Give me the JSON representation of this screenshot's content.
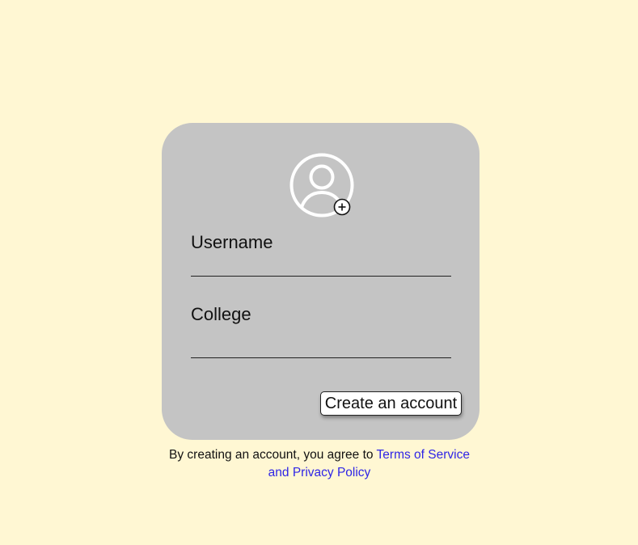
{
  "colors": {
    "background": "#fff7d3",
    "card": "#c4c4c4",
    "link": "#2f25e6",
    "avatar_stroke": "#ffffff"
  },
  "avatar": {
    "icon": "user-circle-icon",
    "badge_icon": "add-circle-icon"
  },
  "form": {
    "username_label": "Username",
    "username_value": "",
    "college_label": "College",
    "college_value": "",
    "submit_label": "Create an account"
  },
  "terms": {
    "prefix": "By creating an account, you agree to ",
    "link_text": "Terms of Service and Privacy Policy"
  }
}
